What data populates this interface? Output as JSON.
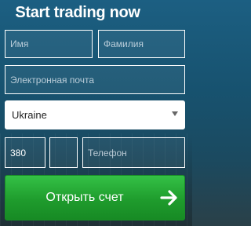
{
  "form": {
    "title": "Start trading now",
    "first_name_placeholder": "Имя",
    "last_name_placeholder": "Фамилия",
    "email_placeholder": "Электронная почта",
    "country_selected": "Ukraine",
    "phone_code_value": "380",
    "phone_area_value": "",
    "phone_placeholder": "Телефон",
    "submit_label": "Открыть счет",
    "submit_icon": "arrow-right-icon",
    "select_icon": "chevron-down-icon"
  },
  "colors": {
    "background": "#1c5f82",
    "button_green": "#2eb13e",
    "field_border": "#ffffff",
    "title_text": "#ffffff"
  }
}
